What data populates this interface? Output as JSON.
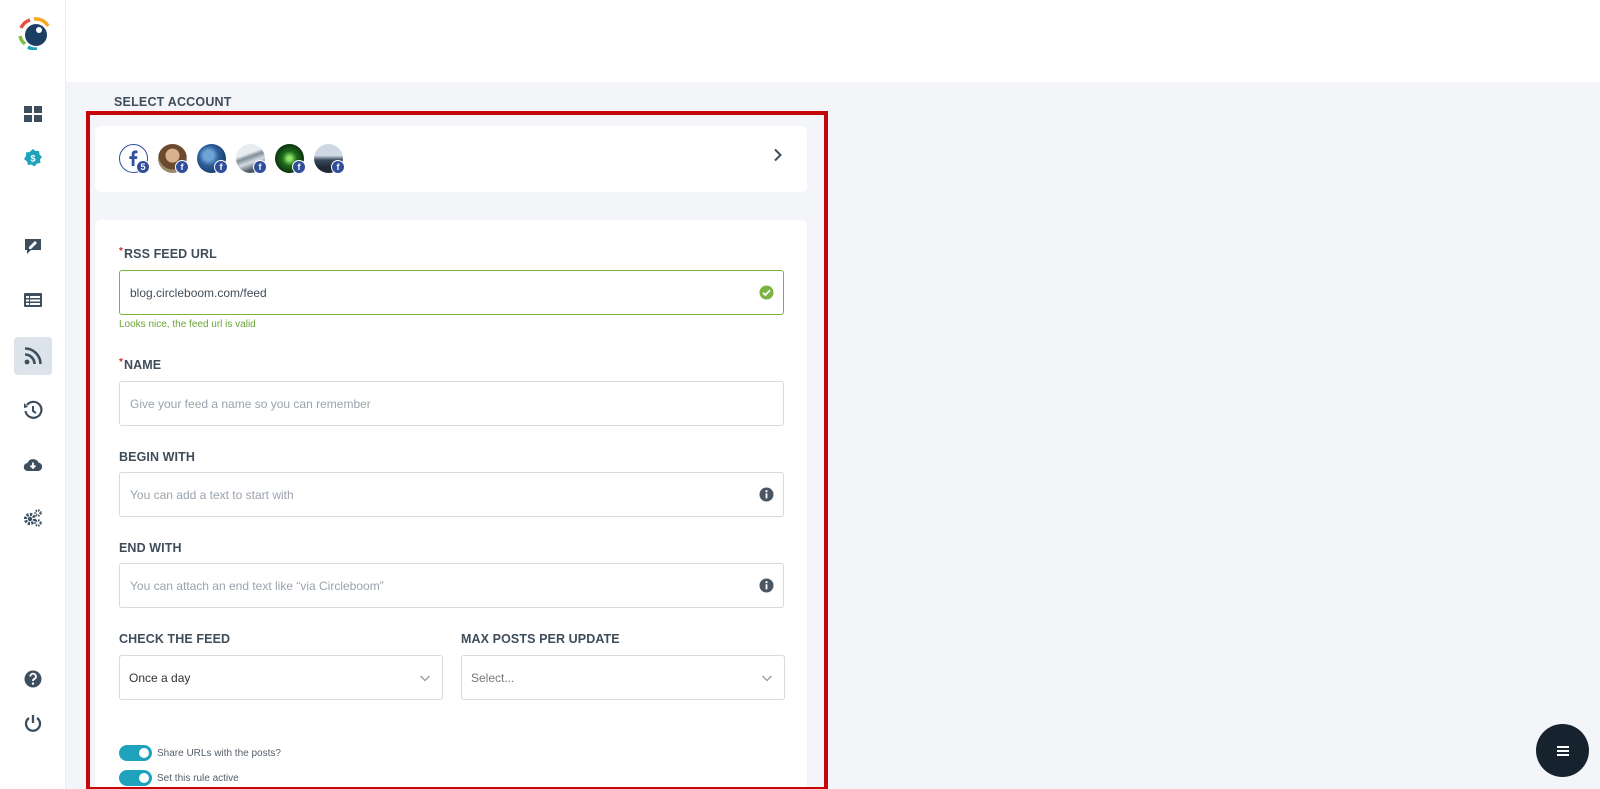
{
  "colors": {
    "accent": "#1fa3bc",
    "nav_icon": "#3d4f5f",
    "valid": "#7cb342",
    "highlight": "#c5070b",
    "facebook": "#2f4f9a"
  },
  "sidebar": {
    "items": [
      {
        "name": "dashboard",
        "icon": "grid-icon"
      },
      {
        "name": "pricing",
        "icon": "dollar-badge-icon"
      },
      {
        "name": "create-post",
        "icon": "edit-icon"
      },
      {
        "name": "queue",
        "icon": "list-icon"
      },
      {
        "name": "rss",
        "icon": "rss-icon",
        "active": true
      },
      {
        "name": "history",
        "icon": "history-icon"
      },
      {
        "name": "download",
        "icon": "cloud-download-icon"
      },
      {
        "name": "settings",
        "icon": "gears-icon"
      },
      {
        "name": "help",
        "icon": "help-icon"
      },
      {
        "name": "logout",
        "icon": "power-icon"
      }
    ]
  },
  "accounts": {
    "label": "SELECT ACCOUNT",
    "group_count": "5"
  },
  "form": {
    "rss_url": {
      "label": "RSS FEED URL",
      "value": "blog.circleboom.com/feed",
      "valid_message": "Looks nice, the feed url is valid"
    },
    "name": {
      "label": "NAME",
      "placeholder": "Give your feed a name so you can remember"
    },
    "begin_with": {
      "label": "BEGIN WITH",
      "placeholder": "You can add a text to start with"
    },
    "end_with": {
      "label": "END WITH",
      "placeholder": "You can attach an end text like “via Circleboom”"
    },
    "check_feed": {
      "label": "CHECK THE FEED",
      "value": "Once a day"
    },
    "max_posts": {
      "label": "MAX POSTS PER UPDATE",
      "placeholder": "Select..."
    },
    "toggles": [
      {
        "label": "Share URLs with the posts?",
        "on": true
      },
      {
        "label": "Set this rule active",
        "on": true
      }
    ]
  }
}
